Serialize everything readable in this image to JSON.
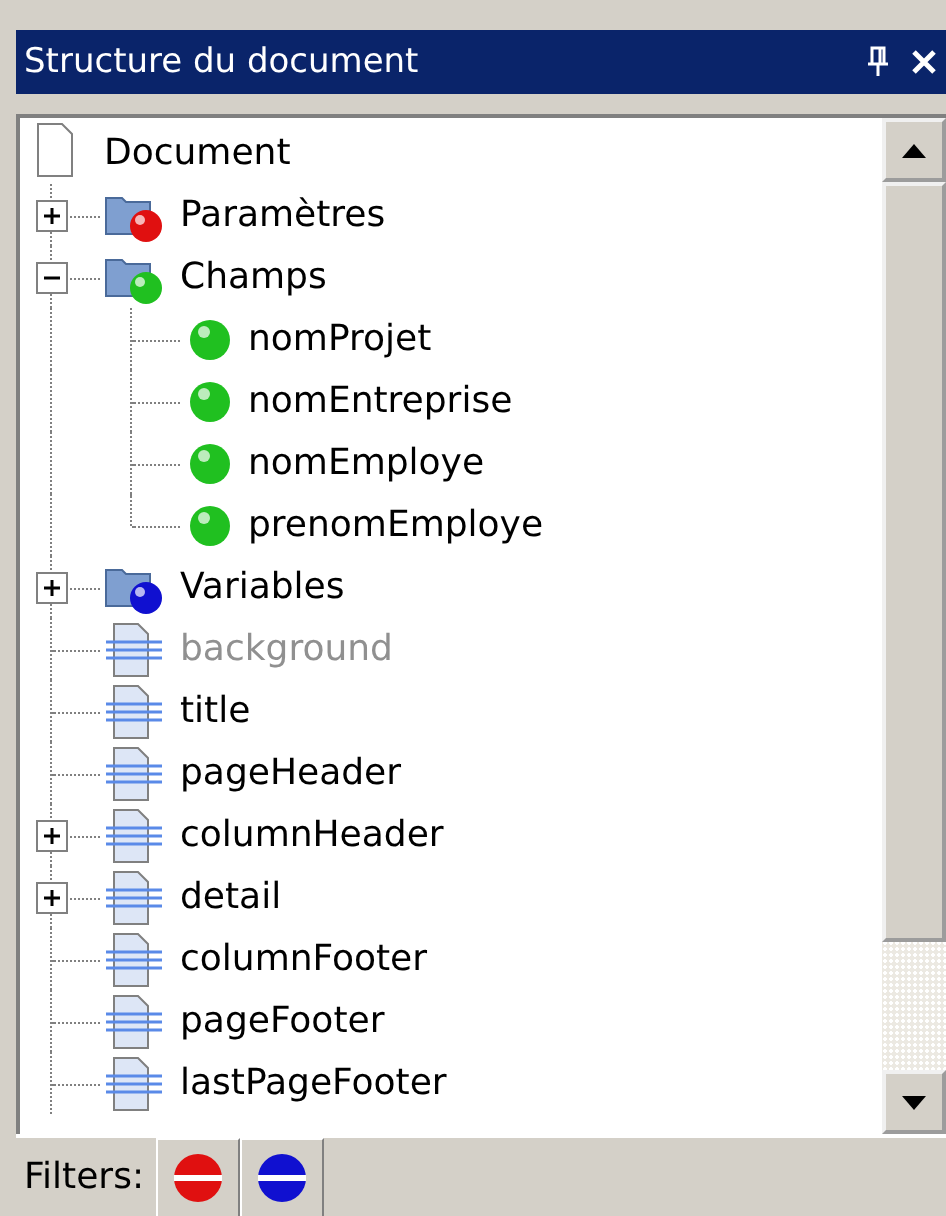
{
  "panel": {
    "title": "Structure du document"
  },
  "tree": {
    "label": "Document",
    "kind": "document",
    "children": [
      {
        "label": "Paramètres",
        "kind": "folder",
        "color": "#e01010",
        "expanded": false,
        "disabled": false
      },
      {
        "label": "Champs",
        "kind": "folder",
        "color": "#20c020",
        "expanded": true,
        "disabled": false,
        "children": [
          {
            "label": "nomProjet",
            "kind": "field"
          },
          {
            "label": "nomEntreprise",
            "kind": "field"
          },
          {
            "label": "nomEmploye",
            "kind": "field"
          },
          {
            "label": "prenomEmploye",
            "kind": "field"
          }
        ]
      },
      {
        "label": "Variables",
        "kind": "folder",
        "color": "#1010d0",
        "expanded": false,
        "disabled": false
      },
      {
        "label": "background",
        "kind": "band",
        "disabled": true
      },
      {
        "label": "title",
        "kind": "band",
        "disabled": false
      },
      {
        "label": "pageHeader",
        "kind": "band",
        "disabled": false
      },
      {
        "label": "columnHeader",
        "kind": "band",
        "expanded": false,
        "disabled": false
      },
      {
        "label": "detail",
        "kind": "band",
        "expanded": false,
        "disabled": false
      },
      {
        "label": "columnFooter",
        "kind": "band",
        "disabled": false
      },
      {
        "label": "pageFooter",
        "kind": "band",
        "disabled": false
      },
      {
        "label": "lastPageFooter",
        "kind": "band",
        "disabled": false
      }
    ]
  },
  "filters": {
    "label": "Filters:",
    "buttons": [
      {
        "color": "#e01010"
      },
      {
        "color": "#1010d0"
      }
    ]
  }
}
